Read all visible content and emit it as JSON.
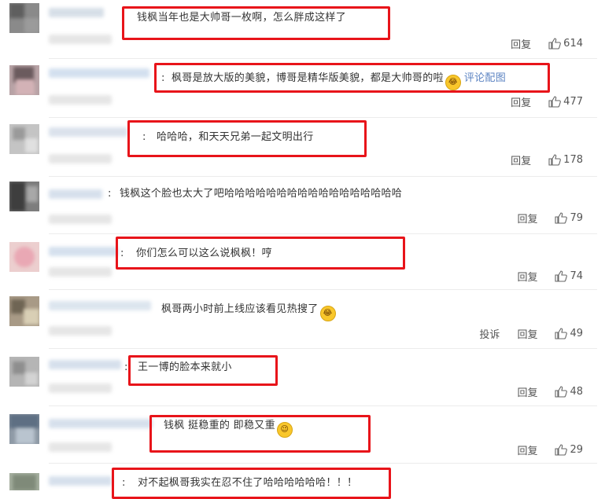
{
  "accent": {
    "highlight": "#e8141a",
    "link": "#5b83c2"
  },
  "comments": [
    {
      "text": "钱枫当年也是大帅哥一枚啊，怎么胖成这样了",
      "reply": "回复",
      "likes": "614"
    },
    {
      "text": "枫哥是放大版的美貌，博哥是精华版美貌，都是大帅哥的啦",
      "emoji": "laughing-emoji",
      "image_link": "评论配图",
      "reply": "回复",
      "likes": "477"
    },
    {
      "text": "哈哈哈，和天天兄弟一起文明出行",
      "reply": "回复",
      "likes": "178"
    },
    {
      "text": "钱枫这个脸也太大了吧哈哈哈哈哈哈哈哈哈哈哈哈哈哈哈哈哈",
      "reply": "回复",
      "likes": "79"
    },
    {
      "text": "你们怎么可以这么说枫枫！哼",
      "reply": "回复",
      "likes": "74"
    },
    {
      "text": "枫哥两小时前上线应该看见热搜了",
      "emoji": "laughing-emoji",
      "report": "投诉",
      "reply": "回复",
      "likes": "49"
    },
    {
      "text": "王一博的脸本来就小",
      "reply": "回复",
      "likes": "48"
    },
    {
      "text": "钱枫 挺稳重的 即稳又重",
      "emoji": "wink-emoji",
      "reply": "回复",
      "likes": "29"
    },
    {
      "text": "对不起枫哥我实在忍不住了哈哈哈哈哈哈！！！"
    }
  ]
}
